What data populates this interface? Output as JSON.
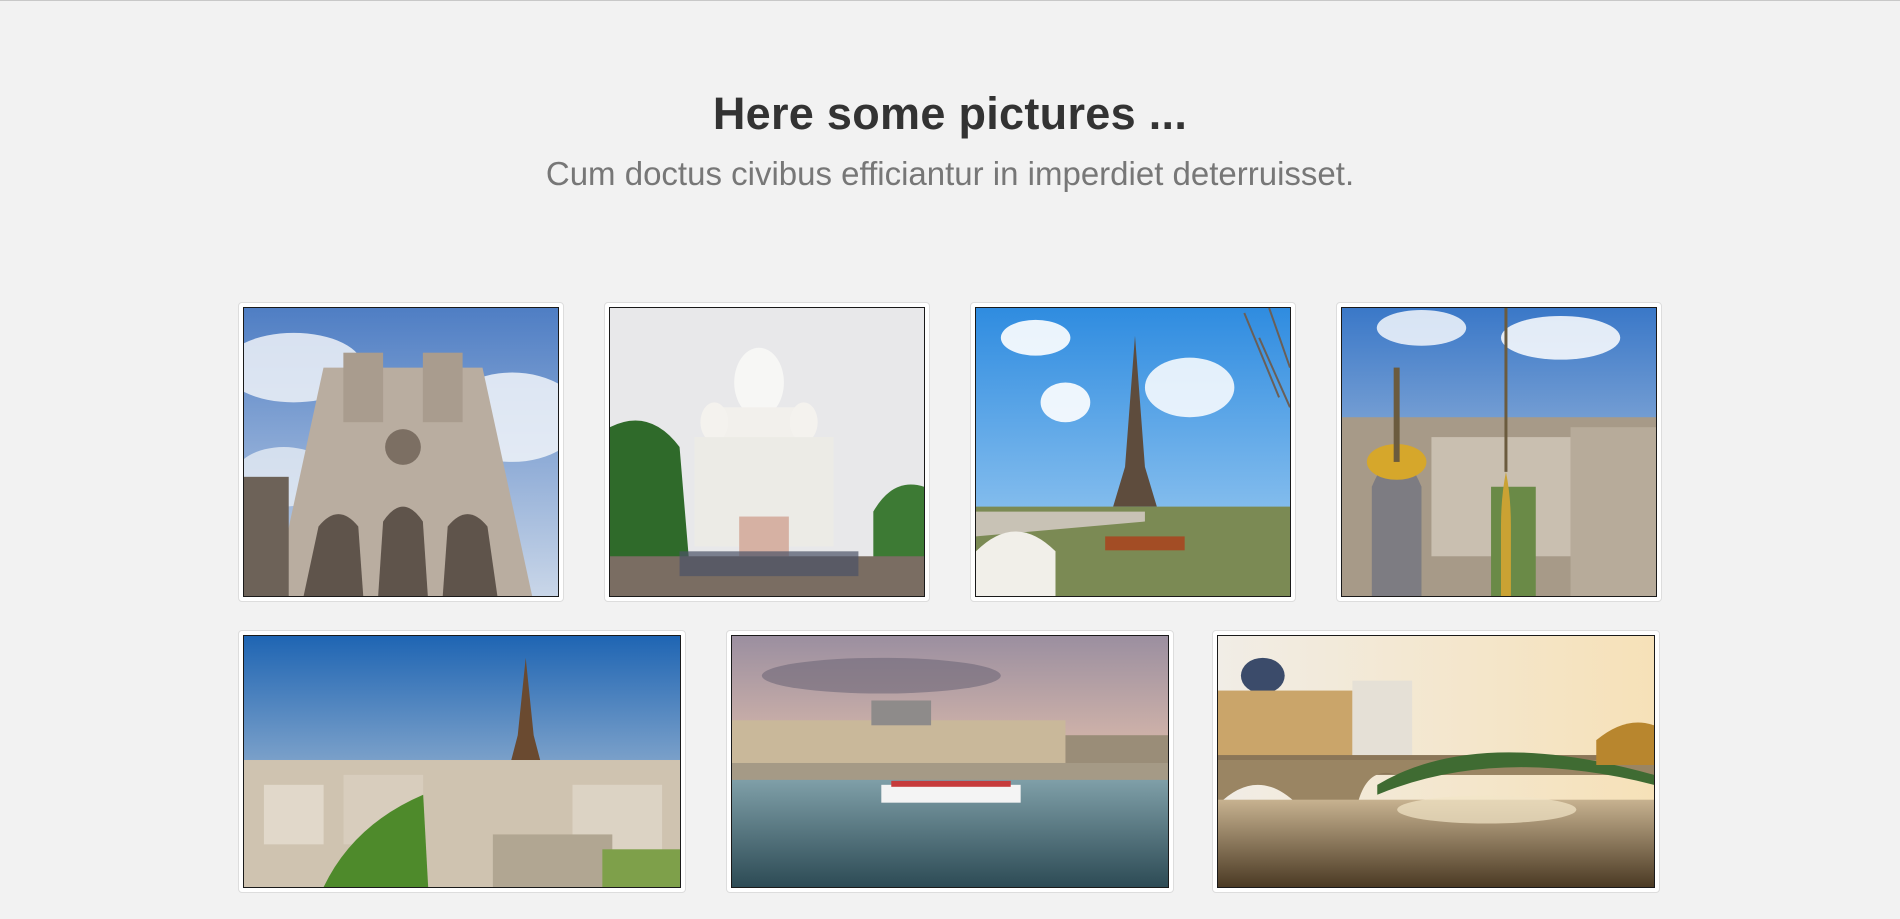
{
  "gallery": {
    "title": "Here some pictures ...",
    "subtitle": "Cum doctus civibus efficiantur in imperdiet deterruisset."
  },
  "photos": [
    {
      "name": "notre-dame-photo"
    },
    {
      "name": "sacre-coeur-photo"
    },
    {
      "name": "eiffel-tower-bridge-photo"
    },
    {
      "name": "paris-rooftops-domes-photo"
    },
    {
      "name": "eiffel-tower-cityscape-photo"
    },
    {
      "name": "musee-dorsay-seine-photo"
    },
    {
      "name": "bridge-seine-reflection-photo"
    }
  ],
  "colors": {
    "background": "#f2f2f2",
    "title": "#333333",
    "subtitle": "#777777"
  }
}
